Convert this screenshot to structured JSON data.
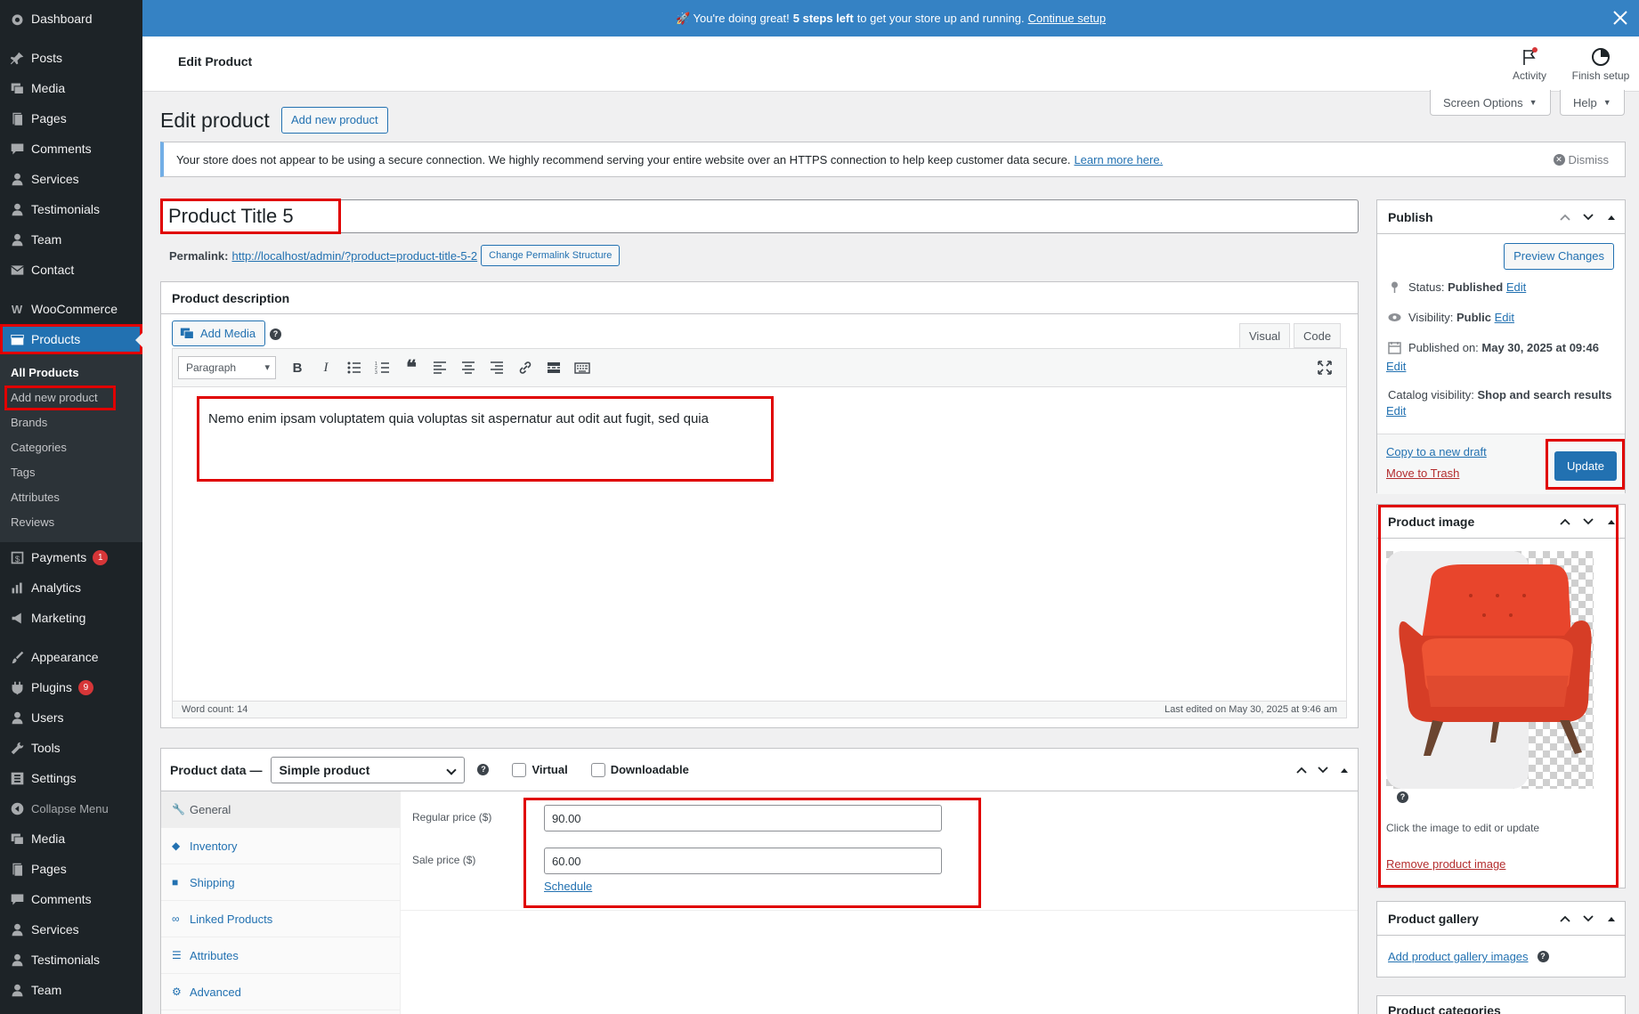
{
  "sidebar": {
    "items": [
      {
        "label": "Dashboard",
        "icon": "dashboard-icon"
      },
      {
        "label": "Posts",
        "icon": "pushpin-icon"
      },
      {
        "label": "Media",
        "icon": "media-icon"
      },
      {
        "label": "Pages",
        "icon": "pages-icon"
      },
      {
        "label": "Comments",
        "icon": "comment-icon"
      },
      {
        "label": "Services",
        "icon": "user-icon"
      },
      {
        "label": "Testimonials",
        "icon": "user-icon"
      },
      {
        "label": "Team",
        "icon": "user-icon"
      },
      {
        "label": "Contact",
        "icon": "mail-icon"
      },
      {
        "label": "WooCommerce",
        "icon": "woo-icon"
      },
      {
        "label": "Products",
        "icon": "products-icon"
      },
      {
        "label": "Payments",
        "icon": "payments-icon",
        "badge": "1"
      },
      {
        "label": "Analytics",
        "icon": "bar-chart-icon"
      },
      {
        "label": "Marketing",
        "icon": "megaphone-icon"
      },
      {
        "label": "Appearance",
        "icon": "brush-icon"
      },
      {
        "label": "Plugins",
        "icon": "plugin-icon",
        "badge": "9"
      },
      {
        "label": "Users",
        "icon": "user-icon"
      },
      {
        "label": "Tools",
        "icon": "wrench-icon"
      },
      {
        "label": "Settings",
        "icon": "settings-icon"
      },
      {
        "label": "Collapse Menu",
        "icon": "collapse-icon"
      },
      {
        "label": "Media",
        "icon": "media-icon"
      },
      {
        "label": "Pages",
        "icon": "pages-icon"
      },
      {
        "label": "Comments",
        "icon": "comment-icon"
      },
      {
        "label": "Services",
        "icon": "user-icon"
      },
      {
        "label": "Testimonials",
        "icon": "user-icon"
      },
      {
        "label": "Team",
        "icon": "user-icon"
      }
    ],
    "products_sub": [
      "All Products",
      "Add new product",
      "Brands",
      "Categories",
      "Tags",
      "Attributes",
      "Reviews"
    ]
  },
  "banner": {
    "prefix": "🚀 You're doing great!",
    "bold": "5 steps left",
    "middle": "to get your store up and running.",
    "link": "Continue setup"
  },
  "header": {
    "title": "Edit Product",
    "activity": "Activity",
    "finish": "Finish setup",
    "screen_options": "Screen Options",
    "help": "Help"
  },
  "page": {
    "title": "Edit product",
    "add_new": "Add new product"
  },
  "notice": {
    "text": "Your store does not appear to be using a secure connection. We highly recommend serving your entire website over an HTTPS connection to help keep customer data secure.",
    "link": "Learn more here.",
    "dismiss": "Dismiss"
  },
  "product": {
    "title": "Product Title 5",
    "permalink_label": "Permalink:",
    "permalink_url": "http://localhost/admin/?product=product-title-5-2",
    "change_permalink": "Change Permalink Structure"
  },
  "description": {
    "heading": "Product description",
    "add_media": "Add Media",
    "tab_visual": "Visual",
    "tab_code": "Code",
    "format": "Paragraph",
    "content": "Nemo enim ipsam voluptatem quia voluptas sit aspernatur aut odit aut fugit, sed quia",
    "word_count": "Word count: 14",
    "last_edited": "Last edited on May 30, 2025 at 9:46 am"
  },
  "product_data": {
    "heading": "Product data —",
    "type": "Simple product",
    "virtual": "Virtual",
    "downloadable": "Downloadable",
    "tabs": [
      {
        "label": "General",
        "icon": "wrench-icon"
      },
      {
        "label": "Inventory",
        "icon": "tag-icon"
      },
      {
        "label": "Shipping",
        "icon": "truck-icon"
      },
      {
        "label": "Linked Products",
        "icon": "link-icon"
      },
      {
        "label": "Attributes",
        "icon": "list-icon"
      },
      {
        "label": "Advanced",
        "icon": "gear-icon"
      }
    ],
    "regular_label": "Regular price ($)",
    "regular_value": "90.00",
    "sale_label": "Sale price ($)",
    "sale_value": "60.00",
    "schedule": "Schedule"
  },
  "publish": {
    "heading": "Publish",
    "preview": "Preview Changes",
    "status_label": "Status:",
    "status_value": "Published",
    "visibility_label": "Visibility:",
    "visibility_value": "Public",
    "published_label": "Published on:",
    "published_value": "May 30, 2025 at 09:46",
    "catalog_label": "Catalog visibility:",
    "catalog_value": "Shop and search results",
    "edit": "Edit",
    "copy_draft": "Copy to a new draft",
    "trash": "Move to Trash",
    "update": "Update"
  },
  "product_image": {
    "heading": "Product image",
    "hint": "Click the image to edit or update",
    "remove": "Remove product image"
  },
  "gallery": {
    "heading": "Product gallery",
    "add": "Add product gallery images"
  },
  "categories": {
    "heading": "Product categories"
  },
  "colors": {
    "sidebar": "#1d2327",
    "accent": "#2271b1",
    "banner": "#3582c4",
    "highlight": "#e00000",
    "chair": "#e8452c"
  }
}
